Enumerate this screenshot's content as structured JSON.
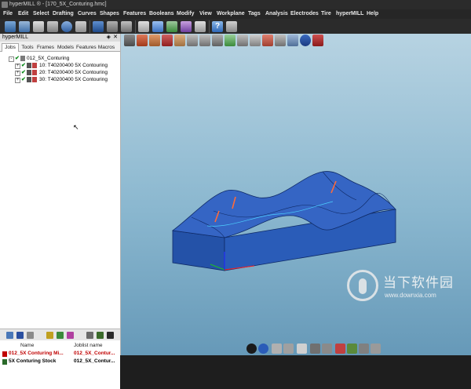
{
  "window": {
    "title": "hyperMILL ® - [170_5X_Conturing.hmc]"
  },
  "menu": [
    "File",
    "Edit",
    "Select",
    "Drafting",
    "Curves",
    "Shapes",
    "Features",
    "Booleans",
    "Modify",
    "View",
    "Workplane",
    "Tags",
    "Analysis",
    "Electrodes",
    "Tire",
    "hyperMILL",
    "Help"
  ],
  "panel": {
    "title": "hyperMILL",
    "pin_icon": "pin-icon",
    "close_icon": "close-icon",
    "tabs": [
      "Jobs",
      "Tools",
      "Frames",
      "Models",
      "Features",
      "Macros"
    ],
    "active_tab": "Jobs",
    "tree": {
      "root": "012_5X_Conturing",
      "jobs": [
        "10: T40200400 5X Contouring",
        "20: T40200400 5X Contouring",
        "30: T40200400 5X Contouring"
      ]
    },
    "bottom_list": {
      "headers": [
        "Name",
        "Joblist name"
      ],
      "rows": [
        {
          "name": "012_5X Conturing Mi...",
          "joblist": "012_5X_Contur...",
          "color": "#c00000"
        },
        {
          "name": "5X Conturing Stock",
          "joblist": "012_5X_Contur...",
          "color": "#000000"
        }
      ]
    }
  },
  "watermark": {
    "text": "当下软件园",
    "url": "www.downxia.com"
  },
  "colors": {
    "model": "#2f62b8",
    "viewport_top": "#b7d3e2",
    "viewport_bottom": "#6699b8"
  }
}
